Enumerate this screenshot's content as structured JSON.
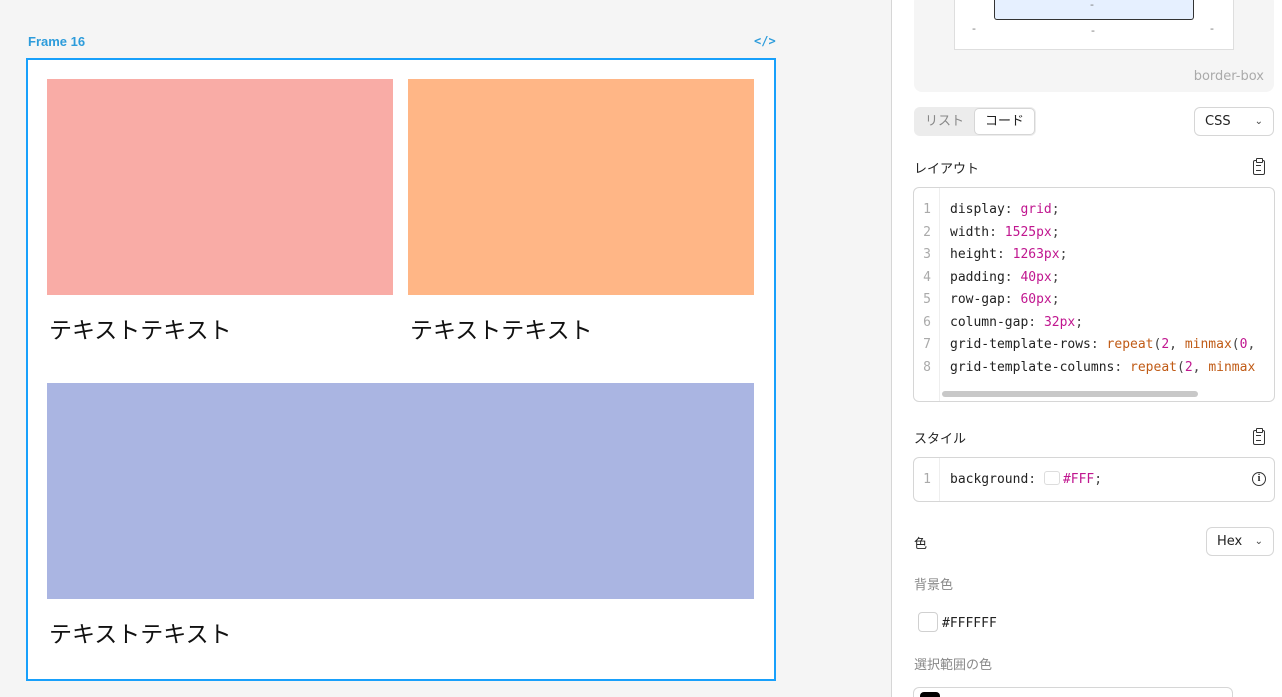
{
  "canvas": {
    "frame_label": "Frame 16",
    "code_toggle": "</>",
    "cards": [
      {
        "color": "#f9aca6",
        "caption": "テキストテキスト"
      },
      {
        "color": "#ffb686",
        "caption": "テキストテキスト"
      },
      {
        "color": "#aab5e2",
        "caption": "テキストテキスト"
      }
    ]
  },
  "panel": {
    "box_model": {
      "dash": "-",
      "box_sizing": "border-box"
    },
    "tabs": [
      {
        "label": "リスト",
        "active": false
      },
      {
        "label": "コード",
        "active": true
      }
    ],
    "lang_select": "CSS",
    "layout_title": "レイアウト",
    "layout_code": [
      {
        "n": "1",
        "prop": "display",
        "parts": [
          {
            "t": "kw",
            "v": "grid"
          }
        ]
      },
      {
        "n": "2",
        "prop": "width",
        "parts": [
          {
            "t": "kw",
            "v": "1525px"
          }
        ]
      },
      {
        "n": "3",
        "prop": "height",
        "parts": [
          {
            "t": "kw",
            "v": "1263px"
          }
        ]
      },
      {
        "n": "4",
        "prop": "padding",
        "parts": [
          {
            "t": "kw",
            "v": "40px"
          }
        ]
      },
      {
        "n": "5",
        "prop": "row-gap",
        "parts": [
          {
            "t": "kw",
            "v": "60px"
          }
        ]
      },
      {
        "n": "6",
        "prop": "column-gap",
        "parts": [
          {
            "t": "kw",
            "v": "32px"
          }
        ]
      },
      {
        "n": "7",
        "prop": "grid-template-rows",
        "parts": [
          {
            "t": "fn",
            "v": "repeat"
          },
          {
            "t": "punc",
            "v": "("
          },
          {
            "t": "kw",
            "v": "2"
          },
          {
            "t": "punc",
            "v": ", "
          },
          {
            "t": "fn",
            "v": "minmax"
          },
          {
            "t": "punc",
            "v": "("
          },
          {
            "t": "kw",
            "v": "0"
          },
          {
            "t": "punc",
            "v": ","
          }
        ]
      },
      {
        "n": "8",
        "prop": "grid-template-columns",
        "parts": [
          {
            "t": "fn",
            "v": "repeat"
          },
          {
            "t": "punc",
            "v": "("
          },
          {
            "t": "kw",
            "v": "2"
          },
          {
            "t": "punc",
            "v": ", "
          },
          {
            "t": "fn",
            "v": "minmax"
          }
        ]
      }
    ],
    "style_title": "スタイル",
    "style_code": {
      "n": "1",
      "prop": "background",
      "value": "#FFF"
    },
    "color_title": "色",
    "color_format": "Hex",
    "bg_label": "背景色",
    "bg_value": "#FFFFFF",
    "selection_label": "選択範囲の色"
  }
}
